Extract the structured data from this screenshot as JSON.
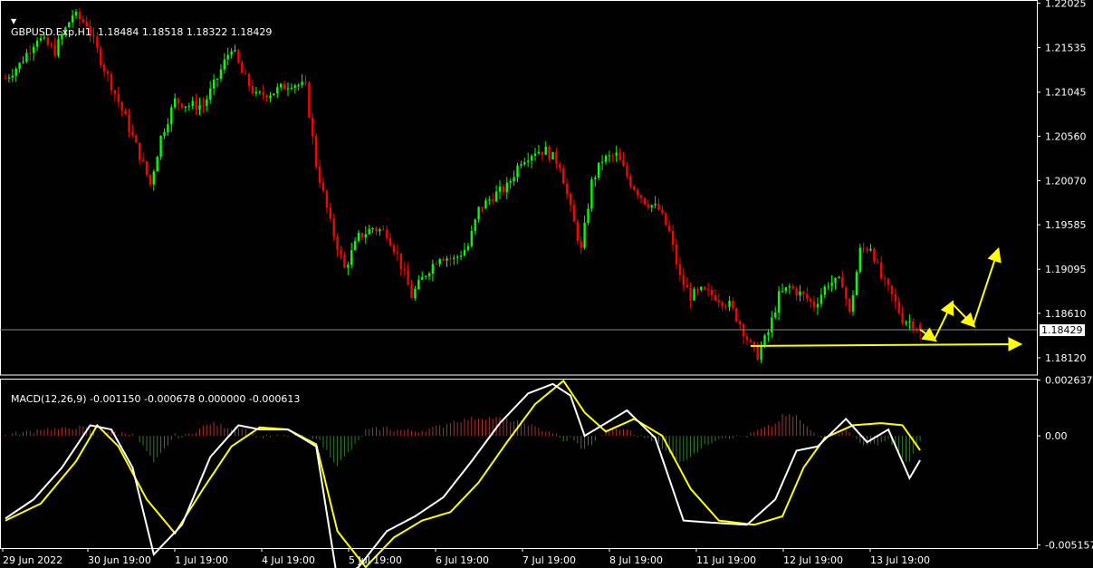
{
  "header": {
    "symbol_line": "GBPUSD.Exp,H1  1.18484 1.18518 1.18322 1.18429",
    "macd_line": "MACD(12,26,9) -0.001150 -0.000678 0.000000 -0.000613"
  },
  "colors": {
    "background": "#000000",
    "frame": "#ffffff",
    "bull_candle": "#00ff00",
    "bear_candle": "#ff0000",
    "histogram_up": "#b03030",
    "histogram_down": "#2e7d32",
    "macd_line": "#ffffff",
    "signal_line": "#ffff00",
    "annotation": "#ffff00"
  },
  "chart_data": [
    {
      "type": "candlestick",
      "symbol": "GBPUSD.Exp",
      "timeframe": "H1",
      "last_ohlc": {
        "open": 1.18484,
        "high": 1.18518,
        "low": 1.18322,
        "close": 1.18429
      },
      "current_price": 1.18429,
      "current_price_label": "1.18429",
      "ylim": [
        1.1793,
        1.2206
      ],
      "y_ticks": [
        "1.22025",
        "1.21535",
        "1.21045",
        "1.20560",
        "1.20070",
        "1.19585",
        "1.19095",
        "1.18610",
        "1.18120"
      ],
      "x_ticks": [
        "29 Jun 2022",
        "30 Jun 19:00",
        "1 Jul 19:00",
        "4 Jul 19:00",
        "5 Jul 19:00",
        "6 Jul 19:00",
        "7 Jul 19:00",
        "8 Jul 19:00",
        "11 Jul 19:00",
        "12 Jul 19:00",
        "13 Jul 19:00"
      ],
      "path_closes": [
        [
          0,
          1.212
        ],
        [
          4,
          1.2135
        ],
        [
          9,
          1.2165
        ],
        [
          14,
          1.215
        ],
        [
          19,
          1.219
        ],
        [
          23,
          1.218
        ],
        [
          27,
          1.214
        ],
        [
          33,
          1.2085
        ],
        [
          38,
          1.2035
        ],
        [
          41,
          1.2003
        ],
        [
          44,
          1.2055
        ],
        [
          48,
          1.2095
        ],
        [
          52,
          1.209
        ],
        [
          56,
          1.209
        ],
        [
          60,
          1.212
        ],
        [
          64,
          1.2155
        ],
        [
          67,
          1.2125
        ],
        [
          71,
          1.21
        ],
        [
          76,
          1.2105
        ],
        [
          81,
          1.2115
        ],
        [
          85,
          1.211
        ],
        [
          88,
          1.2025
        ],
        [
          92,
          1.196
        ],
        [
          96,
          1.191
        ],
        [
          100,
          1.1945
        ],
        [
          104,
          1.1955
        ],
        [
          108,
          1.195
        ],
        [
          111,
          1.1925
        ],
        [
          115,
          1.188
        ],
        [
          119,
          1.1905
        ],
        [
          123,
          1.1925
        ],
        [
          127,
          1.192
        ],
        [
          131,
          1.1935
        ],
        [
          134,
          1.1975
        ],
        [
          138,
          1.199
        ],
        [
          142,
          1.2
        ],
        [
          146,
          1.203
        ],
        [
          150,
          1.204
        ],
        [
          153,
          1.204
        ],
        [
          157,
          1.2025
        ],
        [
          160,
          1.1975
        ],
        [
          163,
          1.193
        ],
        [
          166,
          1.2005
        ],
        [
          169,
          1.203
        ],
        [
          173,
          1.2035
        ],
        [
          177,
          1.2005
        ],
        [
          181,
          1.1985
        ],
        [
          185,
          1.1975
        ],
        [
          188,
          1.195
        ],
        [
          191,
          1.19
        ],
        [
          194,
          1.188
        ],
        [
          197,
          1.1885
        ],
        [
          201,
          1.188
        ],
        [
          205,
          1.187
        ],
        [
          208,
          1.185
        ],
        [
          211,
          1.1825
        ],
        [
          213,
          1.1815
        ],
        [
          216,
          1.184
        ],
        [
          219,
          1.188
        ],
        [
          222,
          1.189
        ],
        [
          226,
          1.188
        ],
        [
          229,
          1.187
        ],
        [
          233,
          1.1895
        ],
        [
          237,
          1.1895
        ],
        [
          239,
          1.186
        ],
        [
          242,
          1.193
        ],
        [
          245,
          1.1935
        ],
        [
          248,
          1.19
        ],
        [
          251,
          1.188
        ],
        [
          254,
          1.1855
        ],
        [
          257,
          1.185
        ],
        [
          259,
          1.1843
        ]
      ],
      "annotations": [
        {
          "type": "arrow-path",
          "color": "#ffff00",
          "points": [
            [
              259,
              1.1843
            ],
            [
              263,
              1.1832
            ],
            [
              268,
              1.1872
            ],
            [
              274,
              1.1848
            ],
            [
              281,
              1.193
            ]
          ]
        },
        {
          "type": "arrow-line",
          "color": "#ffff00",
          "points": [
            [
              211,
              1.1825
            ],
            [
              287,
              1.1827
            ]
          ]
        }
      ]
    },
    {
      "type": "macd",
      "params": "12,26,9",
      "values": {
        "macd": -0.00115,
        "signal": -0.000678,
        "hist_last": -0.000613
      },
      "ylim": [
        -0.0053,
        0.0027
      ],
      "y_ticks": [
        "0.002637",
        "0.00",
        "-0.005157"
      ],
      "macd_path": [
        [
          0,
          -0.0039
        ],
        [
          8,
          -0.003
        ],
        [
          16,
          -0.0015
        ],
        [
          24,
          0.0005
        ],
        [
          30,
          0.0003
        ],
        [
          36,
          -0.0015
        ],
        [
          42,
          -0.0056
        ],
        [
          50,
          -0.0042
        ],
        [
          58,
          -0.001
        ],
        [
          66,
          0.0005
        ],
        [
          72,
          0.0003
        ],
        [
          80,
          0.0003
        ],
        [
          88,
          -0.0005
        ],
        [
          94,
          -0.0068
        ],
        [
          100,
          -0.0062
        ],
        [
          108,
          -0.0045
        ],
        [
          116,
          -0.0038
        ],
        [
          124,
          -0.0029
        ],
        [
          132,
          -0.0012
        ],
        [
          140,
          0.0006
        ],
        [
          148,
          0.002
        ],
        [
          155,
          0.00245
        ],
        [
          160,
          0.0019
        ],
        [
          164,
          0.0
        ],
        [
          168,
          0.0004
        ],
        [
          176,
          0.0012
        ],
        [
          184,
          -0.0001
        ],
        [
          192,
          -0.004
        ],
        [
          200,
          -0.0041
        ],
        [
          210,
          -0.0042
        ],
        [
          218,
          -0.003
        ],
        [
          224,
          -0.0007
        ],
        [
          230,
          -0.0005
        ],
        [
          238,
          0.0008
        ],
        [
          244,
          -0.0003
        ],
        [
          250,
          0.0003
        ],
        [
          256,
          -0.002
        ],
        [
          259,
          -0.00115
        ]
      ],
      "signal_path": [
        [
          0,
          -0.004
        ],
        [
          10,
          -0.0032
        ],
        [
          20,
          -0.0012
        ],
        [
          26,
          0.0005
        ],
        [
          32,
          -0.0005
        ],
        [
          40,
          -0.003
        ],
        [
          48,
          -0.0046
        ],
        [
          56,
          -0.0025
        ],
        [
          64,
          -0.0005
        ],
        [
          72,
          0.0004
        ],
        [
          80,
          0.0003
        ],
        [
          88,
          -0.0004
        ],
        [
          94,
          -0.0045
        ],
        [
          102,
          -0.0062
        ],
        [
          110,
          -0.0048
        ],
        [
          118,
          -0.004
        ],
        [
          126,
          -0.0036
        ],
        [
          134,
          -0.0022
        ],
        [
          142,
          -0.0003
        ],
        [
          150,
          0.0015
        ],
        [
          158,
          0.0026
        ],
        [
          164,
          0.0011
        ],
        [
          170,
          0.0002
        ],
        [
          178,
          0.0008
        ],
        [
          186,
          0.0
        ],
        [
          194,
          -0.0025
        ],
        [
          202,
          -0.004
        ],
        [
          212,
          -0.0042
        ],
        [
          220,
          -0.0038
        ],
        [
          226,
          -0.0015
        ],
        [
          232,
          -0.0001
        ],
        [
          240,
          0.0005
        ],
        [
          248,
          0.0006
        ],
        [
          254,
          0.0005
        ],
        [
          259,
          -0.00068
        ]
      ]
    }
  ]
}
